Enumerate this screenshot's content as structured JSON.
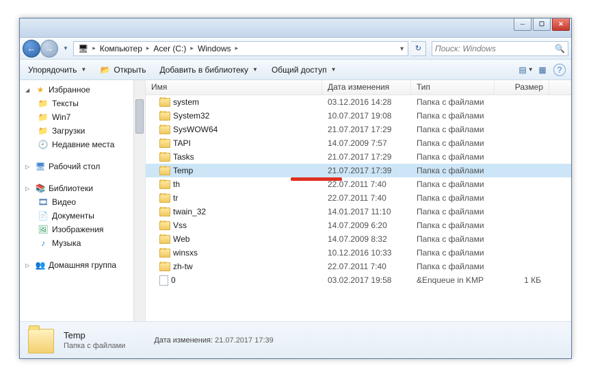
{
  "titlebar": {
    "min": "─",
    "max": "☐",
    "close": "✕"
  },
  "nav": {
    "back": "←",
    "fwd": "→",
    "dd": "▼"
  },
  "breadcrumb": {
    "root_icon": "🖥",
    "items": [
      "Компьютер",
      "Acer (C:)",
      "Windows"
    ],
    "sep": "▸",
    "refresh": "↻"
  },
  "search": {
    "placeholder": "Поиск: Windows",
    "icon": "🔍"
  },
  "toolbar": {
    "organize": "Упорядочить",
    "open": "Открыть",
    "addlib": "Добавить в библиотеку",
    "share": "Общий доступ",
    "chev": "▼",
    "view_icon": "▤",
    "help_icon": "?"
  },
  "sidebar": {
    "fav": {
      "label": "Избранное",
      "tri": "◢"
    },
    "fav_items": [
      "Тексты",
      "Win7",
      "Загрузки",
      "Недавние места"
    ],
    "desk": {
      "label": "Рабочий стол",
      "tri": "▷"
    },
    "lib": {
      "label": "Библиотеки",
      "tri": "▷"
    },
    "lib_items": [
      "Видео",
      "Документы",
      "Изображения",
      "Музыка"
    ],
    "home": {
      "label": "Домашняя группа",
      "tri": "▷"
    }
  },
  "columns": {
    "name": "Имя",
    "date": "Дата изменения",
    "type": "Тип",
    "size": "Размер"
  },
  "rows": [
    {
      "name": "system",
      "date": "03.12.2016 14:28",
      "type": "Папка с файлами",
      "size": "",
      "icon": "folder"
    },
    {
      "name": "System32",
      "date": "10.07.2017 19:08",
      "type": "Папка с файлами",
      "size": "",
      "icon": "folder"
    },
    {
      "name": "SysWOW64",
      "date": "21.07.2017 17:29",
      "type": "Папка с файлами",
      "size": "",
      "icon": "folder"
    },
    {
      "name": "TAPI",
      "date": "14.07.2009 7:57",
      "type": "Папка с файлами",
      "size": "",
      "icon": "folder"
    },
    {
      "name": "Tasks",
      "date": "21.07.2017 17:29",
      "type": "Папка с файлами",
      "size": "",
      "icon": "folder"
    },
    {
      "name": "Temp",
      "date": "21.07.2017 17:39",
      "type": "Папка с файлами",
      "size": "",
      "icon": "folder",
      "selected": true
    },
    {
      "name": "th",
      "date": "22.07.2011 7:40",
      "type": "Папка с файлами",
      "size": "",
      "icon": "folder"
    },
    {
      "name": "tr",
      "date": "22.07.2011 7:40",
      "type": "Папка с файлами",
      "size": "",
      "icon": "folder"
    },
    {
      "name": "twain_32",
      "date": "14.01.2017 11:10",
      "type": "Папка с файлами",
      "size": "",
      "icon": "folder"
    },
    {
      "name": "Vss",
      "date": "14.07.2009 6:20",
      "type": "Папка с файлами",
      "size": "",
      "icon": "folder"
    },
    {
      "name": "Web",
      "date": "14.07.2009 8:32",
      "type": "Папка с файлами",
      "size": "",
      "icon": "folder"
    },
    {
      "name": "winsxs",
      "date": "10.12.2016 10:33",
      "type": "Папка с файлами",
      "size": "",
      "icon": "folder"
    },
    {
      "name": "zh-tw",
      "date": "22.07.2011 7:40",
      "type": "Папка с файлами",
      "size": "",
      "icon": "folder"
    },
    {
      "name": "0",
      "date": "03.02.2017 19:58",
      "type": "&Enqueue in KMP",
      "size": "1 КБ",
      "icon": "file"
    }
  ],
  "details": {
    "name": "Temp",
    "type": "Папка с файлами",
    "date_label": "Дата изменения:",
    "date_value": "21.07.2017 17:39"
  }
}
